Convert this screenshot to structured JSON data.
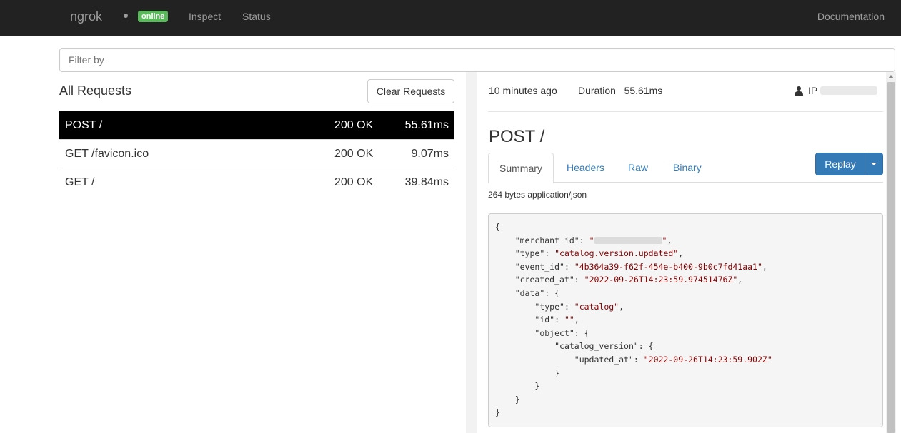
{
  "navbar": {
    "brand": "ngrok",
    "status_badge": "online",
    "links": {
      "inspect": "Inspect",
      "status": "Status",
      "documentation": "Documentation"
    }
  },
  "filter": {
    "placeholder": "Filter by"
  },
  "requests_panel": {
    "title": "All Requests",
    "clear_label": "Clear Requests",
    "rows": [
      {
        "path": "POST /",
        "status": "200 OK",
        "duration": "55.61ms",
        "selected": true
      },
      {
        "path": "GET /favicon.ico",
        "status": "200 OK",
        "duration": "9.07ms",
        "selected": false
      },
      {
        "path": "GET /",
        "status": "200 OK",
        "duration": "39.84ms",
        "selected": false
      }
    ]
  },
  "detail": {
    "time_ago": "10 minutes ago",
    "duration_label": "Duration",
    "duration_value": "55.61ms",
    "ip_label": "IP",
    "title": "POST /",
    "tabs": {
      "summary": "Summary",
      "headers": "Headers",
      "raw": "Raw",
      "binary": "Binary"
    },
    "replay_label": "Replay",
    "body_info": "264 bytes application/json",
    "json": {
      "open": "{",
      "merchant_id_key": "\"merchant_id\"",
      "type_key": "\"type\"",
      "type_val": "\"catalog.version.updated\"",
      "event_id_key": "\"event_id\"",
      "event_id_val": "\"4b364a39-f62f-454e-b400-9b0c7fd41aa1\"",
      "created_at_key": "\"created_at\"",
      "created_at_val": "\"2022-09-26T14:23:59.97451476Z\"",
      "data_key": "\"data\"",
      "data_type_val": "\"catalog\"",
      "id_key": "\"id\"",
      "id_val": "\"\"",
      "object_key": "\"object\"",
      "catalog_version_key": "\"catalog_version\"",
      "updated_at_key": "\"updated_at\"",
      "updated_at_val": "\"2022-09-26T14:23:59.902Z\""
    }
  },
  "colors": {
    "navbar_bg": "#222222",
    "online_badge": "#5cb85c",
    "replay_button": "#337ab7",
    "selected_row": "#000000"
  }
}
